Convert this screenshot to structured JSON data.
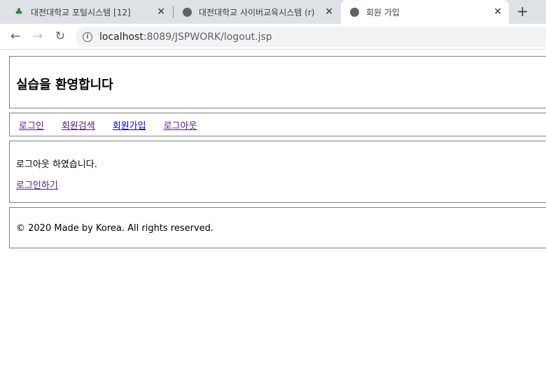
{
  "browser": {
    "tabs": [
      {
        "title": "대전대학교 포털시스템 [12]",
        "icon": "tree-favicon-icon",
        "icon_color": "#2e7d32",
        "active": false
      },
      {
        "title": "대전대학교 사이버교육시스템 (r)",
        "icon": "globe-icon",
        "active": false
      },
      {
        "title": "회원 가입",
        "icon": "globe-icon",
        "active": true
      }
    ],
    "close_glyph": "✕",
    "new_tab_glyph": "+",
    "url_host": "localhost",
    "url_path": ":8089/JSPWORK/logout.jsp"
  },
  "page": {
    "header_title": "실습을 환영합니다",
    "nav": [
      {
        "label": "로그인",
        "visited": true
      },
      {
        "label": "회원검색",
        "visited": true
      },
      {
        "label": "회원가입",
        "visited": false
      },
      {
        "label": "로그아웃",
        "visited": true
      }
    ],
    "message": "로그아웃 하였습니다.",
    "login_link": "로그인하기",
    "footer": "© 2020 Made by Korea. All rights reserved."
  }
}
